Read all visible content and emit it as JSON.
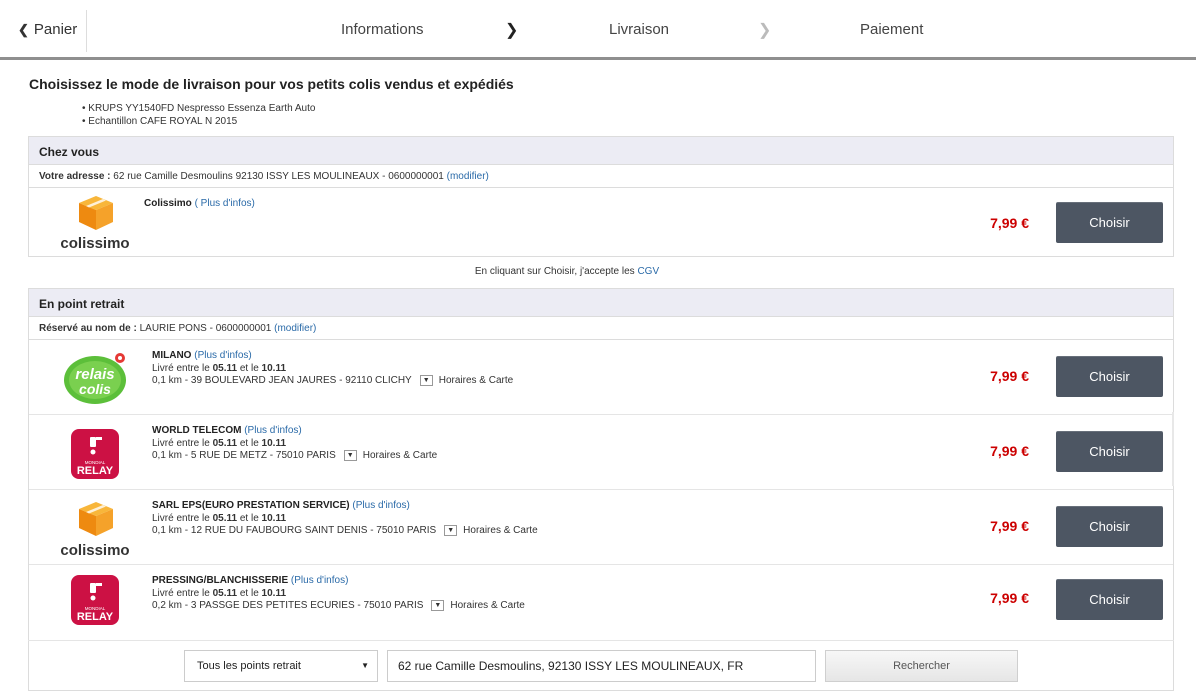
{
  "nav": {
    "back_label": "Panier",
    "steps": [
      "Informations",
      "Livraison",
      "Paiement"
    ]
  },
  "title": "Choisissez le mode de livraison pour vos petits colis vendus et expédiés",
  "items": [
    "• KRUPS YY1540FD Nespresso Essenza Earth Auto",
    "• Echantillon CAFE ROYAL N 2015"
  ],
  "home": {
    "header": "Chez vous",
    "address_label": "Votre adresse :",
    "address": " 62 rue Camille Desmoulins 92130 ISSY LES MOULINEAUX - 0600000001 ",
    "modify": "(modifier)",
    "carrier": "Colissimo",
    "more_info": "( Plus d'infos)",
    "price": "7,99 €",
    "button": "Choisir",
    "logo_text": "colissimo"
  },
  "cgv": {
    "text": "En cliquant sur Choisir, j'accepte les ",
    "link": "CGV"
  },
  "relay": {
    "header": "En point retrait",
    "reserved_label": "Réservé au nom de :",
    "reserved_value": " LAURIE PONS - 0600000001 ",
    "modify": "(modifier)",
    "points": [
      {
        "name": "MILANO",
        "more": "(Plus d'infos)",
        "delivery_prefix": "Livré entre le ",
        "date1": "05.11",
        "between": " et le ",
        "date2": "10.11",
        "address": "0,1 km - 39 BOULEVARD JEAN JAURES - 92110 CLICHY",
        "hours": "Horaires & Carte",
        "price": "7,99 €",
        "button": "Choisir",
        "logo": "relais-colis"
      },
      {
        "name": "WORLD TELECOM",
        "more": "(Plus d'infos)",
        "delivery_prefix": "Livré entre le ",
        "date1": "05.11",
        "between": " et le ",
        "date2": "10.11",
        "address": "0,1 km - 5 RUE DE METZ - 75010 PARIS",
        "hours": "Horaires & Carte",
        "price": "7,99 €",
        "button": "Choisir",
        "logo": "mondial-relay"
      },
      {
        "name": "SARL EPS(EURO PRESTATION SERVICE)",
        "more": "(Plus d'infos)",
        "delivery_prefix": "Livré entre le ",
        "date1": "05.11",
        "between": " et le ",
        "date2": "10.11",
        "address": "0,1 km - 12 RUE DU FAUBOURG SAINT DENIS - 75010 PARIS",
        "hours": "Horaires & Carte",
        "price": "7,99 €",
        "button": "Choisir",
        "logo": "colissimo"
      },
      {
        "name": "PRESSING/BLANCHISSERIE",
        "more": "(Plus d'infos)",
        "delivery_prefix": "Livré entre le ",
        "date1": "05.11",
        "between": " et le ",
        "date2": "10.11",
        "address": "0,2 km - 3 PASSGE DES PETITES ECURIES - 75010 PARIS",
        "hours": "Horaires & Carte",
        "price": "7,99 €",
        "button": "Choisir",
        "logo": "mondial-relay"
      }
    ]
  },
  "logos": {
    "relais_line1": "relais",
    "relais_line2": "colis",
    "mondial_small": "MONDIAL",
    "mondial_big": "RELAY",
    "colissimo": "colissimo"
  },
  "search": {
    "filter_value": "Tous les points retrait",
    "address_value": "62 rue Camille Desmoulins, 92130 ISSY LES MOULINEAUX, FR",
    "button": "Rechercher"
  },
  "colors": {
    "price": "#cc0000",
    "button": "#4d5663",
    "link": "#2a6aa8",
    "header_bg": "#ececf4",
    "colissimo": "#f39c12",
    "mondial": "#d0103a",
    "relais": "#4caf3c"
  }
}
